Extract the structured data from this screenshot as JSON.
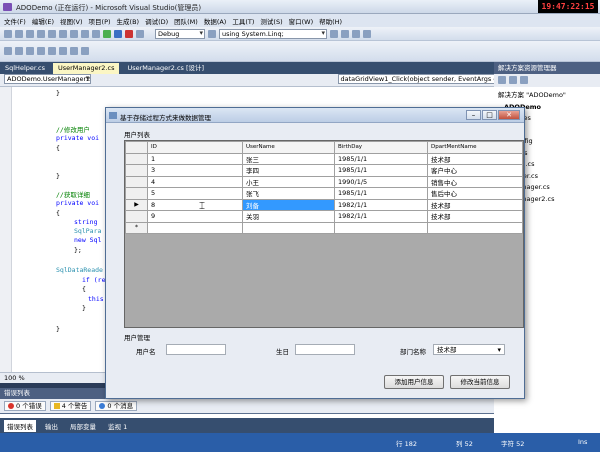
{
  "window": {
    "title": "ADODemo (正在运行) - Microsoft Visual Studio(管理员)",
    "clock": "19:47:22:15"
  },
  "menu": [
    "文件(F)",
    "编辑(E)",
    "视图(V)",
    "项目(P)",
    "生成(B)",
    "调试(D)",
    "团队(M)",
    "数据(A)",
    "工具(T)",
    "测试(S)",
    "窗口(W)",
    "帮助(H)"
  ],
  "toolbar": {
    "config": "Debug",
    "find": "using System.Linq;"
  },
  "doc_tabs": [
    "SqlHelper.cs",
    "UserManager2.cs",
    "UserManager2.cs [设计]"
  ],
  "nav": {
    "class": "ADODemo.UserManager2",
    "member": "dataGridView1_Click(object sender, EventArgs e)"
  },
  "code_lines": [
    {
      "text": "}",
      "kind": "plain"
    },
    {
      "text": "//修改用户",
      "kind": "comment"
    },
    {
      "text": "private voi",
      "kind": "kw"
    },
    {
      "text": "{",
      "kind": "plain"
    },
    {
      "text": "}",
      "kind": "plain"
    },
    {
      "text": "//获取详细",
      "kind": "comment"
    },
    {
      "text": "private voi",
      "kind": "kw"
    },
    {
      "text": "{",
      "kind": "plain"
    },
    {
      "text": "string",
      "kind": "kw"
    },
    {
      "text": "SqlPara",
      "kind": "type"
    },
    {
      "text": "new Sql",
      "kind": "kw"
    },
    {
      "text": "};",
      "kind": "plain"
    },
    {
      "text": "SqlDataReade",
      "kind": "type"
    },
    {
      "text": "if (read",
      "kind": "kw"
    },
    {
      "text": "{",
      "kind": "plain"
    },
    {
      "text": "this",
      "kind": "kw"
    },
    {
      "text": "}",
      "kind": "plain"
    },
    {
      "text": "}",
      "kind": "plain"
    }
  ],
  "zoom": "100 %",
  "error_panel": {
    "title": "错误列表",
    "errors": "0 个错误",
    "warnings": "4 个警告",
    "messages": "0 个消息"
  },
  "bottom_tabs": [
    "错误列表",
    "输出",
    "局部变量",
    "监视 1"
  ],
  "status": {
    "row": "行 182",
    "col": "列 52",
    "char": "字符 52",
    "mode": "Ins"
  },
  "solution": {
    "title": "解决方案资源管理器",
    "root": "解决方案 \"ADODemo\"",
    "project": "ADODemo",
    "items": [
      "Properties",
      "引用",
      "App.config",
      "Form1.cs",
      "Program.cs",
      "SqlHelper.cs",
      "UserManager.cs",
      "UserManager2.cs"
    ]
  },
  "dialog": {
    "title": "基于存储过程方式来做数据管理",
    "group_list": "用户列表",
    "group_manage": "用户管理",
    "columns": [
      "ID",
      "UserName",
      "BirthDay",
      "DpartMentName"
    ],
    "rows": [
      [
        "1",
        "张三",
        "1985/1/1",
        "技术部"
      ],
      [
        "3",
        "李四",
        "1985/1/1",
        "客户中心"
      ],
      [
        "4",
        "小王",
        "1990/1/5",
        "销售中心"
      ],
      [
        "5",
        "张飞",
        "1985/1/1",
        "售后中心"
      ],
      [
        "8",
        "刘备",
        "1982/1/1",
        "技术部"
      ],
      [
        "9",
        "关羽",
        "1982/1/1",
        "技术部"
      ]
    ],
    "new_row_marker": "*",
    "labels": {
      "username": "用户名",
      "birthday": "生日",
      "dept": "部门名称"
    },
    "dept_value": "技术部",
    "btn_add": "添加用户信息",
    "btn_edit": "修改当前信息"
  }
}
